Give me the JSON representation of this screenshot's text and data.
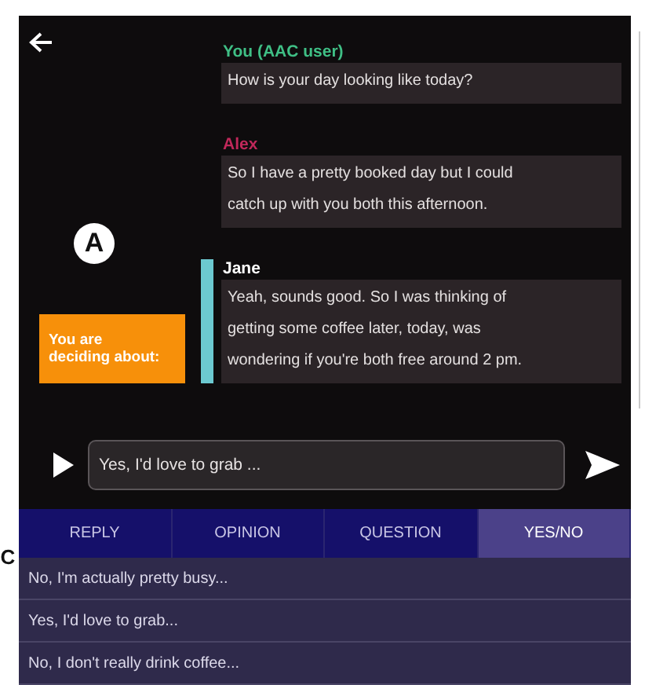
{
  "markers": [
    {
      "label": "A",
      "kind": "screen"
    },
    {
      "label": "C",
      "kind": "edge"
    }
  ],
  "messages": [
    {
      "sender": "You (AAC user)",
      "color": "#3fbf85",
      "text": "How is your day looking like today?",
      "focused": false
    },
    {
      "sender": "Alex",
      "color": "#c0285a",
      "text": "So I have a pretty booked day but I could catch up with you both this afternoon.",
      "focused": false
    },
    {
      "sender": "Jane",
      "color": "#ffffff",
      "text": "Yeah, sounds good. So I was thinking of getting some coffee later, today, was wondering if you're both free around 2 pm.",
      "focused": true
    }
  ],
  "decision_label": "You are deciding about:",
  "composer": {
    "value": "Yes, I'd love to grab ..."
  },
  "tabs": [
    {
      "label": "REPLY",
      "selected": false
    },
    {
      "label": "OPINION",
      "selected": false
    },
    {
      "label": "QUESTION",
      "selected": false
    },
    {
      "label": "YES/NO",
      "selected": true
    }
  ],
  "suggestions": [
    "No, I'm actually pretty busy...",
    "Yes, I'd love to grab...",
    "No, I don't really drink coffee..."
  ]
}
